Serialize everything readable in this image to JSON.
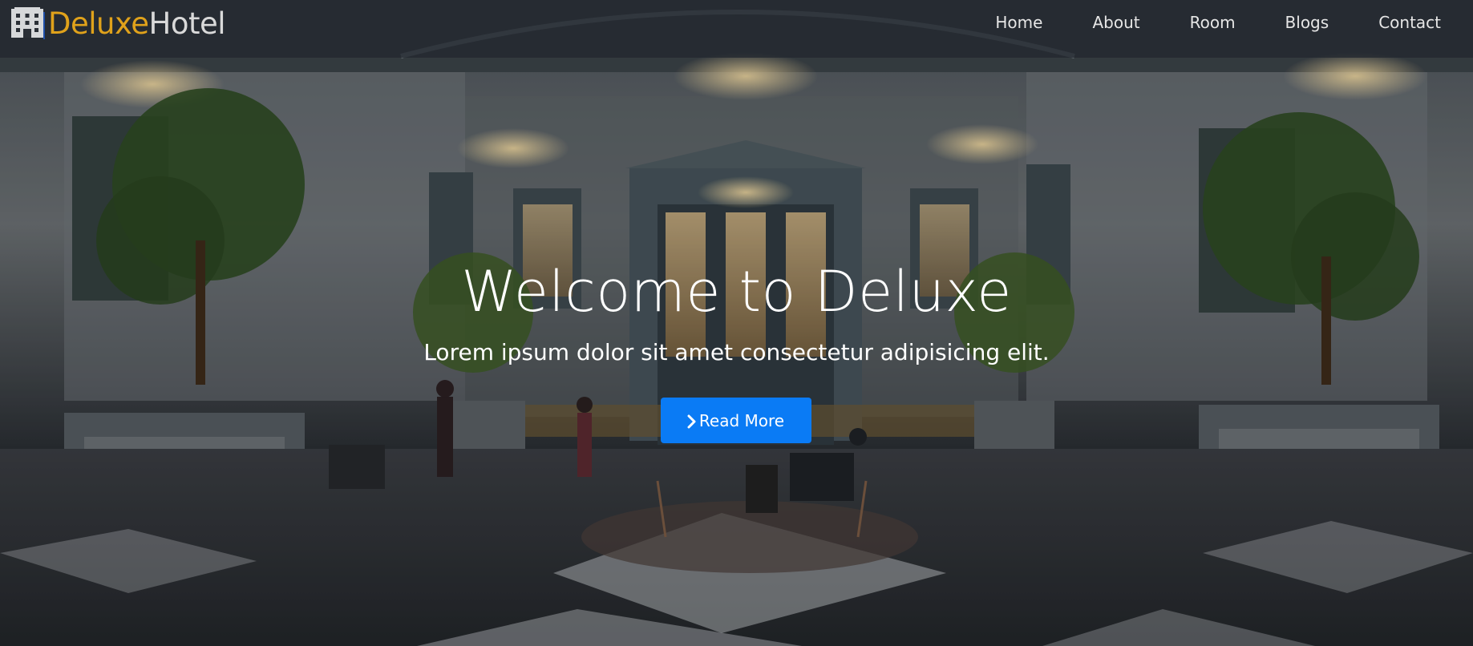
{
  "brand": {
    "icon": "hotel-building-icon",
    "name_part1": "Deluxe",
    "name_part2": "Hotel",
    "accent_color": "#e0a21b"
  },
  "nav": {
    "items": [
      {
        "label": "Home"
      },
      {
        "label": "About"
      },
      {
        "label": "Room"
      },
      {
        "label": "Blogs"
      },
      {
        "label": "Contact"
      }
    ]
  },
  "hero": {
    "title": "Welcome to Deluxe",
    "subtitle": "Lorem ipsum dolor sit amet consectetur adipisicing elit.",
    "button": {
      "label": "Read More",
      "icon": "chevron-right-icon",
      "color": "#0a7bf5"
    }
  }
}
